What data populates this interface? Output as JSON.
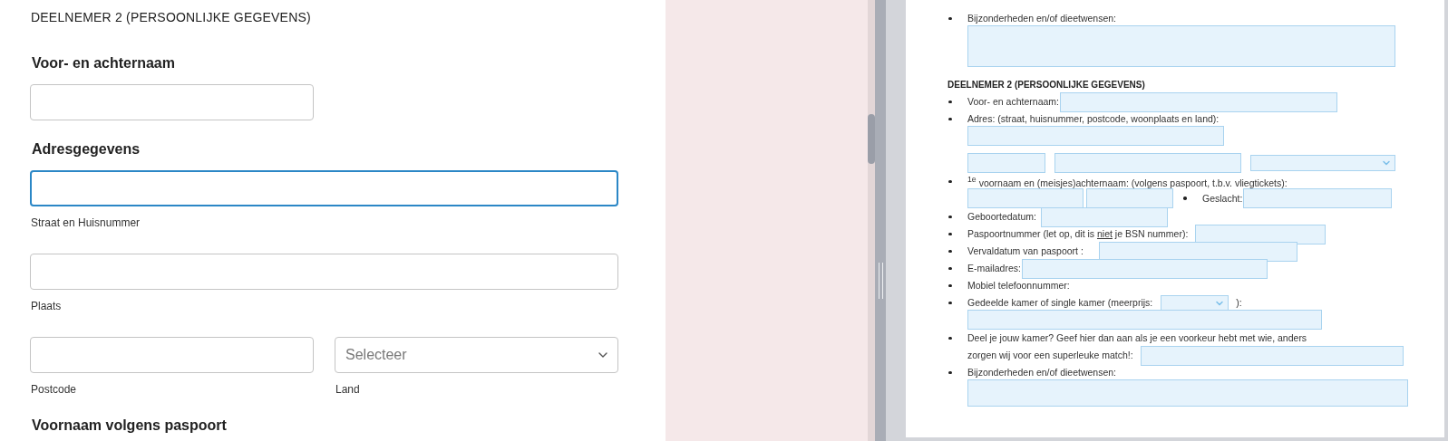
{
  "form": {
    "title": "DEELNEMER 2 (PERSOONLIJKE GEGEVENS)",
    "groups": [
      {
        "label": "Voor- en achternaam",
        "rows": [
          {
            "kind": "split",
            "fields": [
              {
                "kind": "text",
                "focused": false
              }
            ]
          }
        ]
      },
      {
        "label": "Adresgegevens",
        "rows": [
          {
            "kind": "full",
            "fields": [
              {
                "kind": "text",
                "focused": true,
                "caption": "Straat en Huisnummer"
              }
            ]
          },
          {
            "kind": "full",
            "fields": [
              {
                "kind": "text",
                "focused": false,
                "caption": "Plaats"
              }
            ]
          },
          {
            "kind": "split",
            "fields": [
              {
                "kind": "text",
                "focused": false,
                "caption": "Postcode"
              },
              {
                "kind": "select",
                "focused": false,
                "placeholder": "Selecteer",
                "caption": "Land"
              }
            ]
          }
        ]
      },
      {
        "label": "Voornaam volgens paspoort"
      }
    ]
  },
  "document": {
    "items": [
      {
        "kind": "bullet",
        "lines": [
          "Bijzonderheden en/of dieetwensen:"
        ],
        "below": [
          [
            {
              "kind": "area"
            }
          ]
        ]
      },
      {
        "kind": "heading",
        "text": "DEELNEMER 2 (PERSOONLIJKE GEGEVENS)"
      },
      {
        "kind": "bullet",
        "lines": [
          "Voor- en achternaam:"
        ],
        "inline": [
          {
            "kind": "text"
          }
        ]
      },
      {
        "kind": "bullet",
        "lines": [
          "Adres: (straat, huisnummer, postcode, woonplaats en land):"
        ],
        "below": [
          [
            {
              "kind": "text"
            }
          ],
          [
            {
              "kind": "text"
            },
            {
              "kind": "text"
            },
            {
              "kind": "select"
            }
          ]
        ]
      },
      {
        "kind": "bullet",
        "lines": [
          "$^{1e}$ voornaam en (meisjes)achternaam:  (volgens paspoort, t.b.v. vliegtickets):"
        ],
        "below": [
          [
            {
              "kind": "text"
            },
            {
              "kind": "text"
            },
            {
              "kind": "bullet_label",
              "text": "Geslacht:"
            },
            {
              "kind": "text"
            }
          ]
        ]
      },
      {
        "kind": "bullet",
        "lines": [
          "Geboortedatum:"
        ],
        "inline": [
          {
            "kind": "text"
          }
        ]
      },
      {
        "kind": "bullet",
        "lines": [
          {
            "segments": [
              {
                "text": "Paspoortnummer (let op, dit is ",
                "underline": false
              },
              {
                "text": "niet",
                "underline": true
              },
              {
                "text": " je BSN nummer):",
                "underline": false
              }
            ]
          }
        ],
        "inline": [
          {
            "kind": "text"
          }
        ]
      },
      {
        "kind": "bullet",
        "lines": [
          "Vervaldatum van paspoort :"
        ],
        "inline": [
          {
            "kind": "text"
          }
        ]
      },
      {
        "kind": "bullet",
        "lines": [
          "E-mailadres:"
        ],
        "inline": [
          {
            "kind": "text"
          }
        ]
      },
      {
        "kind": "bullet",
        "lines": [
          "Mobiel telefoonnummer:"
        ]
      },
      {
        "kind": "bullet",
        "lines": [
          "Gedeelde kamer of single kamer (meerprijs:"
        ],
        "inline": [
          {
            "kind": "select"
          },
          {
            "kind": "label",
            "text": "):"
          }
        ],
        "below": [
          [
            {
              "kind": "text"
            }
          ]
        ]
      },
      {
        "kind": "bullet",
        "lines": [
          "Deel je jouw kamer? Geef hier dan aan als je een voorkeur hebt met wie, anders",
          "zorgen wij voor een superleuke match!:"
        ],
        "inline": [
          {
            "kind": "text"
          }
        ]
      },
      {
        "kind": "bullet",
        "lines": [
          "Bijzonderheden en/of dieetwensen:"
        ],
        "below": [
          [
            {
              "kind": "area"
            }
          ]
        ]
      }
    ]
  }
}
